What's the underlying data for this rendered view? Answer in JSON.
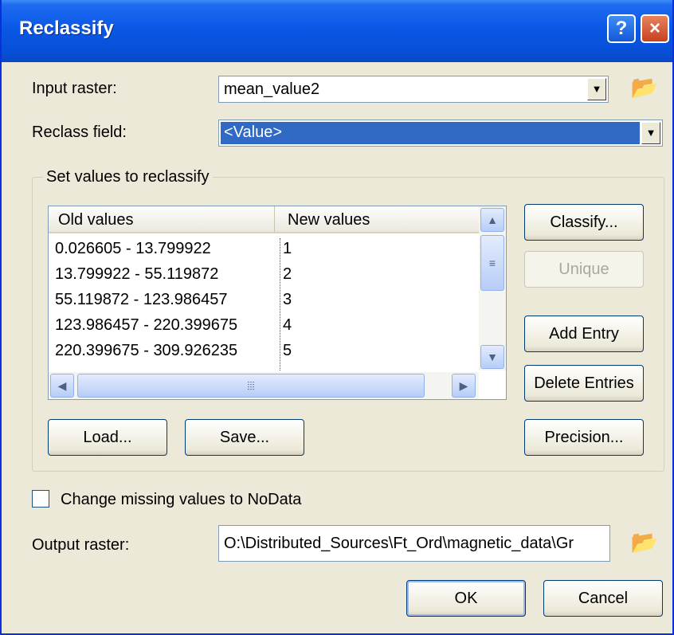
{
  "window": {
    "title": "Reclassify",
    "help_label": "?",
    "close_label": "×"
  },
  "input_raster": {
    "label": "Input raster:",
    "value": "mean_value2",
    "browse_icon": "open-folder-icon"
  },
  "reclass_field": {
    "label": "Reclass field:",
    "value": "<Value>"
  },
  "group": {
    "title": "Set values to reclassify"
  },
  "table": {
    "columns": [
      "Old values",
      "New values"
    ],
    "rows": [
      {
        "old": "0.026605 - 13.799922",
        "new": "1"
      },
      {
        "old": "13.799922 - 55.119872",
        "new": "2"
      },
      {
        "old": "55.119872 - 123.986457",
        "new": "3"
      },
      {
        "old": "123.986457 - 220.399675",
        "new": "4"
      },
      {
        "old": "220.399675 - 309.926235",
        "new": "5"
      }
    ]
  },
  "buttons": {
    "classify": "Classify...",
    "unique": "Unique",
    "add_entry": "Add Entry",
    "delete_entries": "Delete Entries",
    "load": "Load...",
    "save": "Save...",
    "precision": "Precision...",
    "ok": "OK",
    "cancel": "Cancel"
  },
  "missing_nodata": {
    "label": "Change missing values to NoData",
    "checked": false
  },
  "output_raster": {
    "label": "Output raster:",
    "value": "O:\\Distributed_Sources\\Ft_Ord\\magnetic_data\\Gr"
  },
  "colors": {
    "titlebar": "#0a58e6",
    "dialog_bg": "#ece9d8",
    "selection": "#316ac5"
  }
}
